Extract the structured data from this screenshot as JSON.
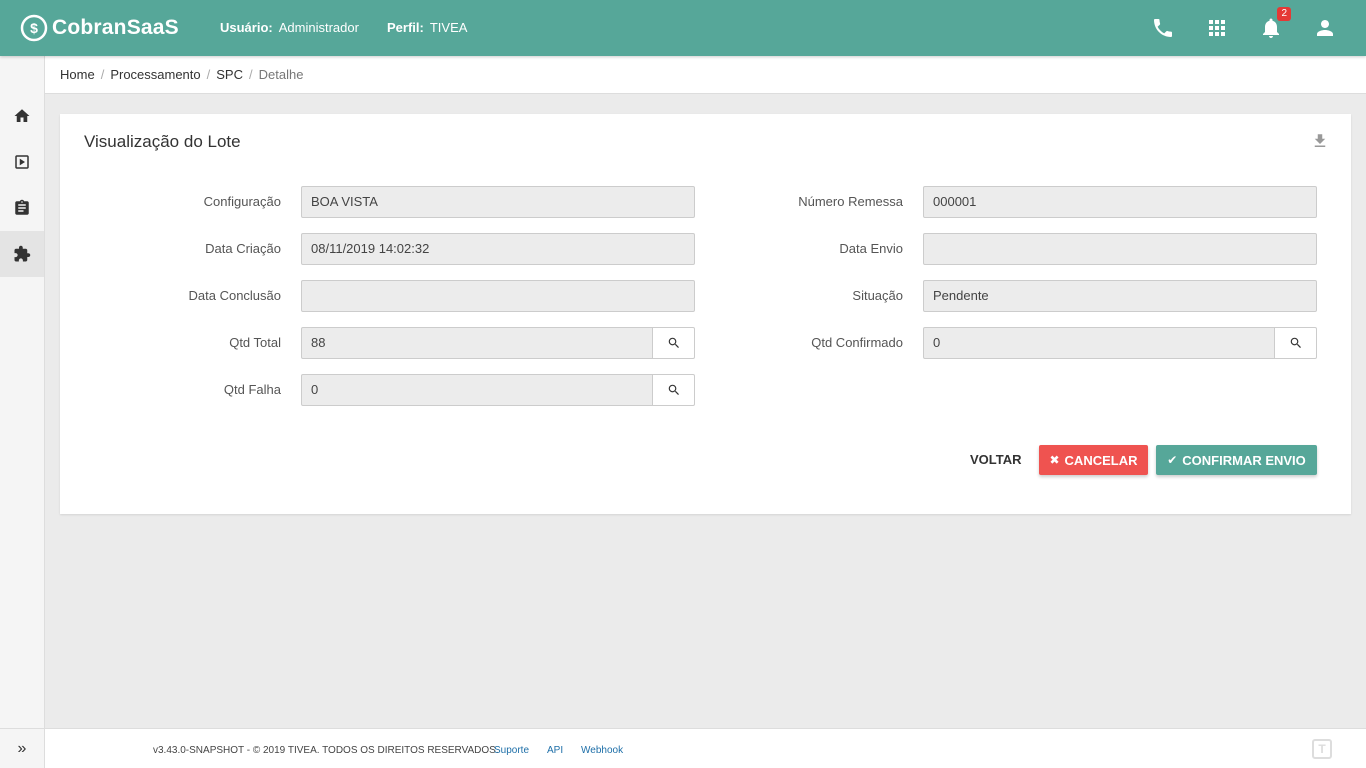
{
  "app": {
    "brand": "CobranSaaS",
    "user_label": "Usuário:",
    "user_value": "Administrador",
    "profile_label": "Perfil:",
    "profile_value": "TIVEA",
    "notification_count": "2",
    "accent_color": "#56a799"
  },
  "breadcrumb": {
    "items": [
      "Home",
      "Processamento",
      "SPC",
      "Detalhe"
    ],
    "separator": "/"
  },
  "card": {
    "title": "Visualização do Lote"
  },
  "fields": {
    "configuracao": {
      "label": "Configuração",
      "value": "BOA VISTA"
    },
    "data_criacao": {
      "label": "Data Criação",
      "value": "08/11/2019 14:02:32"
    },
    "data_conclusao": {
      "label": "Data Conclusão",
      "value": ""
    },
    "qtd_total": {
      "label": "Qtd Total",
      "value": "88"
    },
    "qtd_falha": {
      "label": "Qtd Falha",
      "value": "0"
    },
    "numero_remessa": {
      "label": "Número Remessa",
      "value": "000001"
    },
    "data_envio": {
      "label": "Data Envio",
      "value": ""
    },
    "situacao": {
      "label": "Situação",
      "value": "Pendente"
    },
    "qtd_confirmado": {
      "label": "Qtd Confirmado",
      "value": "0"
    }
  },
  "actions": {
    "voltar": "VOLTAR",
    "cancelar": "CANCELAR",
    "confirmar": "CONFIRMAR ENVIO",
    "cancel_color": "#ef5350"
  },
  "footer": {
    "copyright": "v3.43.0-SNAPSHOT - © 2019 TIVEA. TODOS OS DIREITOS RESERVADOS.",
    "links": [
      "Suporte",
      "API",
      "Webhook"
    ],
    "logo_mark": "T"
  },
  "icons": {
    "phone": "phone-icon",
    "apps": "apps-grid-icon",
    "notifications": "bell-icon",
    "account": "user-icon",
    "download": "download-icon",
    "search": "search-icon",
    "home": "home-icon",
    "play": "play-box-icon",
    "clipboard": "clipboard-icon",
    "puzzle": "puzzle-icon",
    "expand": "double-chevron-right-icon"
  }
}
